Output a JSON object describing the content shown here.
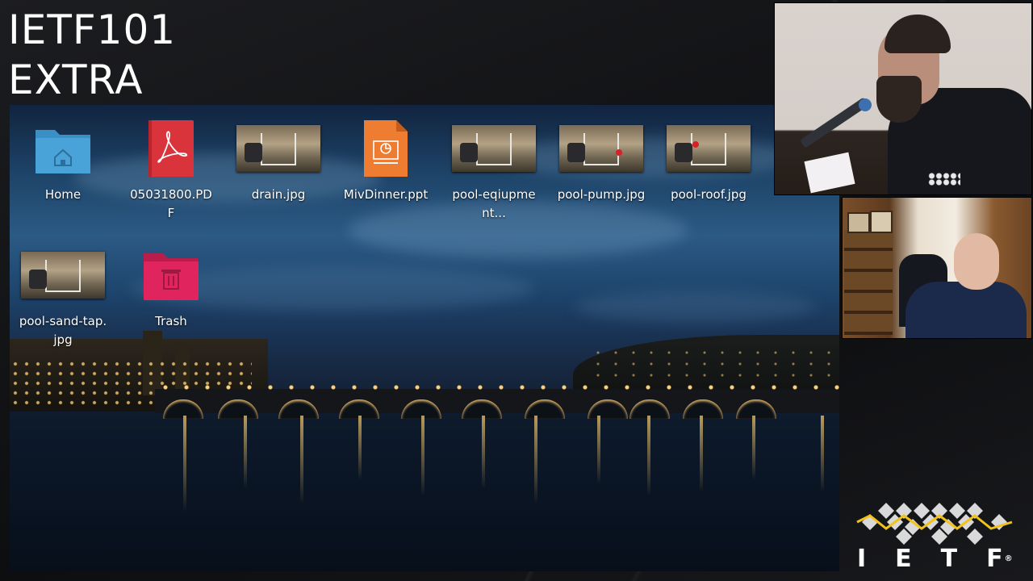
{
  "event": {
    "line1": "IETF101",
    "line2": "EXTRA"
  },
  "desktop": {
    "icons": [
      {
        "label": "Home",
        "kind": "home-folder-icon",
        "color": "#4aa3d8"
      },
      {
        "label": "05031800.PDF",
        "kind": "pdf-file-icon",
        "color": "#d9343c"
      },
      {
        "label": "drain.jpg",
        "kind": "image-thumbnail"
      },
      {
        "label": "MivDinner.ppt",
        "kind": "presentation-file-icon",
        "color": "#ee7d32"
      },
      {
        "label": "pool-eqiupment...",
        "kind": "image-thumbnail"
      },
      {
        "label": "pool-pump.jpg",
        "kind": "image-thumbnail"
      },
      {
        "label": "pool-roof.jpg",
        "kind": "image-thumbnail"
      },
      {
        "label": "pool-sand-tap.jpg",
        "kind": "image-thumbnail"
      },
      {
        "label": "Trash",
        "kind": "trash-folder-icon",
        "color": "#e0245e"
      }
    ]
  },
  "logo": {
    "text": "IETF",
    "trademark": "®",
    "accent": "#f2c21a"
  }
}
